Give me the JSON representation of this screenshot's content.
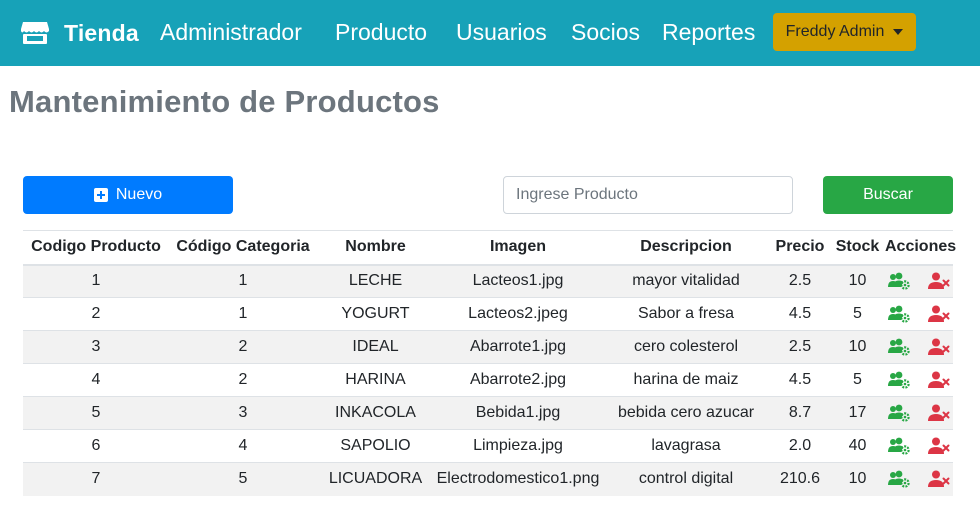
{
  "navbar": {
    "brand": "Tienda",
    "brand_icon": "store-icon",
    "links": [
      "Administrador",
      "Producto",
      "Usuarios",
      "Socios",
      "Reportes"
    ],
    "user_menu": "Freddy Admin",
    "background": "#17a2b8",
    "user_menu_color": "#d4a100"
  },
  "page": {
    "title": "Mantenimiento de Productos"
  },
  "toolbar": {
    "new_label": "Nuevo",
    "search_placeholder": "Ingrese Producto",
    "search_value": "",
    "search_label": "Buscar",
    "new_color": "#007bff",
    "search_color": "#28a745"
  },
  "table": {
    "headers": [
      "Codigo Producto",
      "Código Categoria",
      "Nombre",
      "Imagen",
      "Descripcion",
      "Precio",
      "Stock",
      "Acciones"
    ],
    "rows": [
      [
        "1",
        "1",
        "LECHE",
        "Lacteos1.jpg",
        "mayor vitalidad",
        "2.5",
        "10"
      ],
      [
        "2",
        "1",
        "YOGURT",
        "Lacteos2.jpeg",
        "Sabor a fresa",
        "4.5",
        "5"
      ],
      [
        "3",
        "2",
        "IDEAL",
        "Abarrote1.jpg",
        "cero colesterol",
        "2.5",
        "10"
      ],
      [
        "4",
        "2",
        "HARINA",
        "Abarrote2.jpg",
        "harina de maiz",
        "4.5",
        "5"
      ],
      [
        "5",
        "3",
        "INKACOLA",
        "Bebida1.jpg",
        "bebida cero azucar",
        "8.7",
        "17"
      ],
      [
        "6",
        "4",
        "SAPOLIO",
        "Limpieza.jpg",
        "lavagrasa",
        "2.0",
        "40"
      ],
      [
        "7",
        "5",
        "LICUADORA",
        "Electrodomestico1.png",
        "control digital",
        "210.6",
        "10"
      ]
    ],
    "action_icons": [
      "edit-users-icon",
      "delete-user-icon"
    ],
    "edit_color": "#28a745",
    "delete_color": "#dc3545"
  }
}
